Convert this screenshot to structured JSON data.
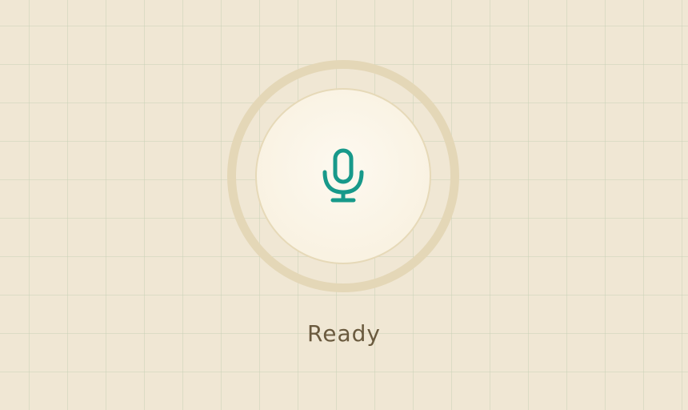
{
  "recorder": {
    "status": "Ready",
    "icon": "microphone-icon"
  },
  "colors": {
    "accent": "#17998a",
    "status_text": "#6a5a3e",
    "ring": "#e4d7b7",
    "background": "#f0e7d4"
  }
}
